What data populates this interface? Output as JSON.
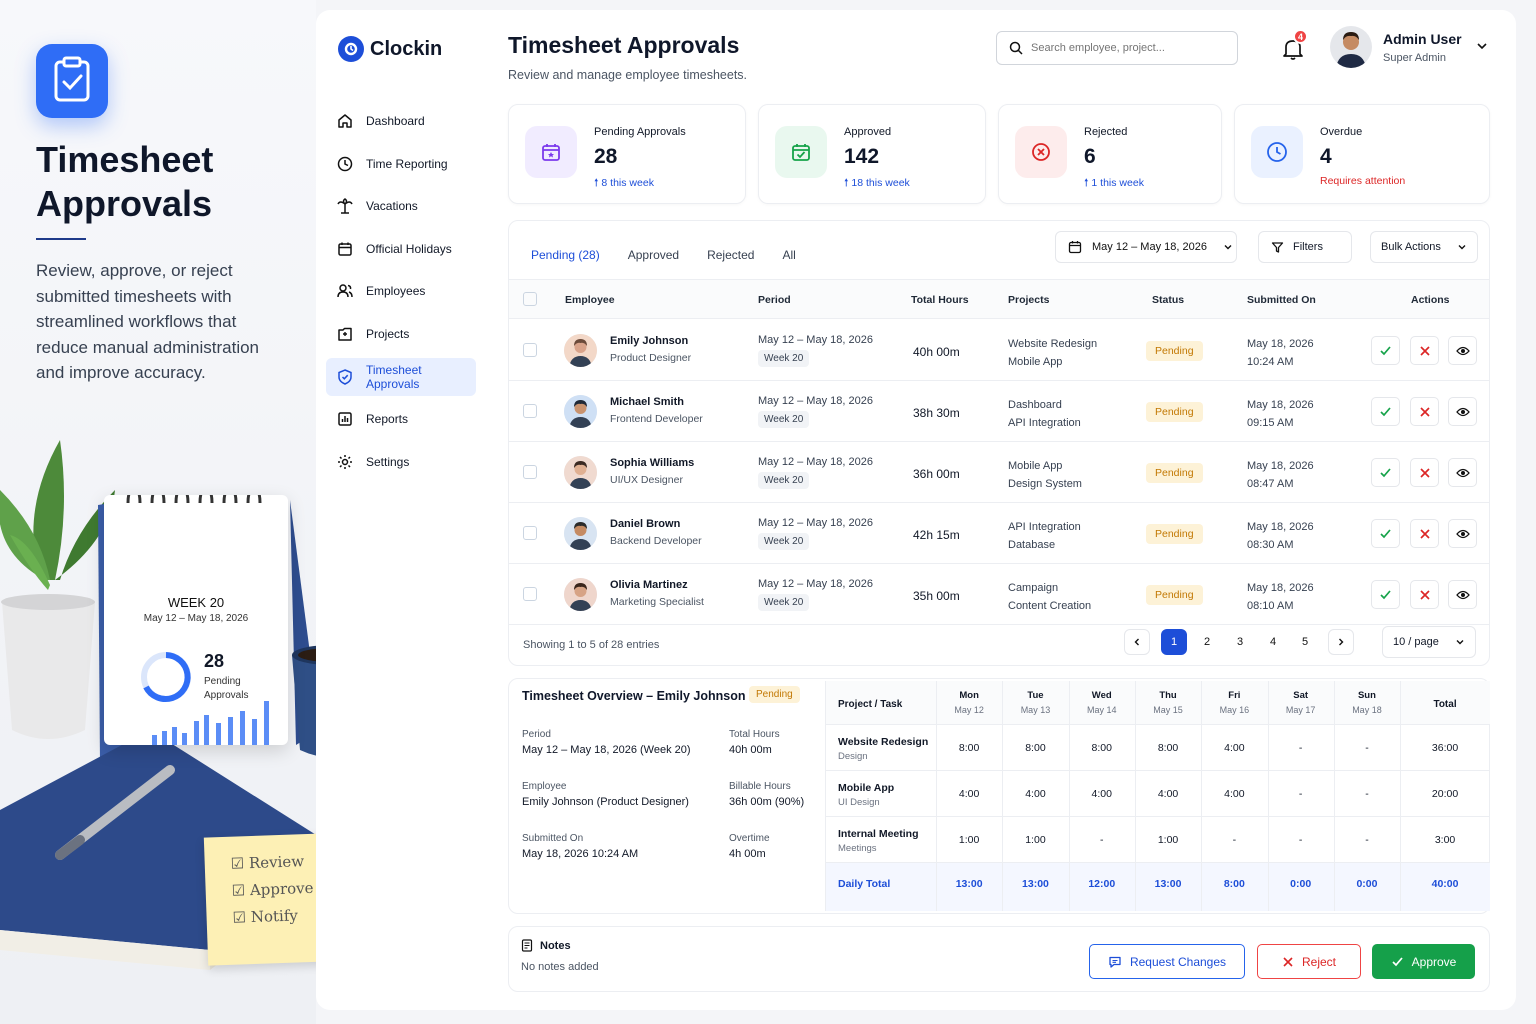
{
  "hero": {
    "title": "Timesheet Approvals",
    "description": "Review, approve, or reject submitted timesheets with streamlined workflows that reduce manual administration and improve accuracy."
  },
  "illustration": {
    "calendar_week": "WEEK 20",
    "calendar_range": "May 12 – May 18, 2026",
    "calendar_count": "28",
    "calendar_label": "Pending Approvals",
    "sticky_items": [
      "Review",
      "Approve",
      "Notify"
    ]
  },
  "brand": {
    "name": "Clockin"
  },
  "nav": [
    {
      "label": "Dashboard",
      "icon": "home-icon"
    },
    {
      "label": "Time Reporting",
      "icon": "clock-icon"
    },
    {
      "label": "Vacations",
      "icon": "palm-tree-icon"
    },
    {
      "label": "Official Holidays",
      "icon": "calendar-icon"
    },
    {
      "label": "Employees",
      "icon": "users-icon"
    },
    {
      "label": "Projects",
      "icon": "folder-icon"
    },
    {
      "label": "Timesheet Approvals",
      "icon": "shield-check-icon",
      "active": true
    },
    {
      "label": "Reports",
      "icon": "chart-icon"
    },
    {
      "label": "Settings",
      "icon": "gear-icon"
    }
  ],
  "header": {
    "title": "Timesheet Approvals",
    "subtitle": "Review and manage employee timesheets.",
    "search_placeholder": "Search employee, project...",
    "notification_count": "4",
    "user_name": "Admin User",
    "user_role": "Super Admin"
  },
  "stats": [
    {
      "label": "Pending Approvals",
      "value": "28",
      "note": "8 this week",
      "color": "#7c3aed",
      "bg": "#f1ecff"
    },
    {
      "label": "Approved",
      "value": "142",
      "note": "18 this week",
      "color": "#16a34a",
      "bg": "#e9f8ef"
    },
    {
      "label": "Rejected",
      "value": "6",
      "note": "1 this week",
      "color": "#dc2626",
      "bg": "#fdecec"
    },
    {
      "label": "Overdue",
      "value": "4",
      "note": "Requires attention",
      "color": "#2563eb",
      "bg": "#eaf1ff"
    }
  ],
  "tabs": [
    "Pending (28)",
    "Approved",
    "Rejected",
    "All"
  ],
  "toolbar": {
    "date_range": "May 12 – May 18, 2026",
    "filters": "Filters",
    "bulk_actions": "Bulk Actions"
  },
  "table": {
    "columns": [
      "Employee",
      "Period",
      "Total Hours",
      "Projects",
      "Status",
      "Submitted On",
      "Actions"
    ],
    "rows": [
      {
        "name": "Emily Johnson",
        "role": "Product Designer",
        "period": "May 12 – May 18, 2026",
        "week": "Week 20",
        "hours": "40h 00m",
        "project1": "Website Redesign",
        "project2": "Mobile App",
        "status": "Pending",
        "date": "May 18, 2026",
        "time": "10:24 AM"
      },
      {
        "name": "Michael Smith",
        "role": "Frontend Developer",
        "period": "May 12 – May 18, 2026",
        "week": "Week 20",
        "hours": "38h 30m",
        "project1": "Dashboard",
        "project2": "API Integration",
        "status": "Pending",
        "date": "May 18, 2026",
        "time": "09:15 AM"
      },
      {
        "name": "Sophia Williams",
        "role": "UI/UX Designer",
        "period": "May 12 – May 18, 2026",
        "week": "Week 20",
        "hours": "36h 00m",
        "project1": "Mobile App",
        "project2": "Design System",
        "status": "Pending",
        "date": "May 18, 2026",
        "time": "08:47 AM"
      },
      {
        "name": "Daniel Brown",
        "role": "Backend Developer",
        "period": "May 12 – May 18, 2026",
        "week": "Week 20",
        "hours": "42h 15m",
        "project1": "API Integration",
        "project2": "Database",
        "status": "Pending",
        "date": "May 18, 2026",
        "time": "08:30 AM"
      },
      {
        "name": "Olivia Martinez",
        "role": "Marketing Specialist",
        "period": "May 12 – May 18, 2026",
        "week": "Week 20",
        "hours": "35h 00m",
        "project1": "Campaign",
        "project2": "Content Creation",
        "status": "Pending",
        "date": "May 18, 2026",
        "time": "08:10 AM"
      }
    ]
  },
  "pagination": {
    "info": "Showing 1 to 5 of 28 entries",
    "pages": [
      "1",
      "2",
      "3",
      "4",
      "5"
    ],
    "per_page": "10 / page"
  },
  "overview": {
    "title": "Timesheet Overview – Emily Johnson",
    "status": "Pending",
    "fields": {
      "period_label": "Period",
      "period_value": "May 12 – May 18, 2026 (Week 20)",
      "total_label": "Total Hours",
      "total_value": "40h 00m",
      "employee_label": "Employee",
      "employee_value": "Emily Johnson (Product Designer)",
      "billable_label": "Billable Hours",
      "billable_value": "36h 00m (90%)",
      "submitted_label": "Submitted On",
      "submitted_value": "May 18, 2026 10:24 AM",
      "overtime_label": "Overtime",
      "overtime_value": "4h 00m"
    },
    "grid": {
      "task_header": "Project / Task",
      "total_header": "Total",
      "days": [
        {
          "day": "Mon",
          "date": "May 12"
        },
        {
          "day": "Tue",
          "date": "May 13"
        },
        {
          "day": "Wed",
          "date": "May 14"
        },
        {
          "day": "Thu",
          "date": "May 15"
        },
        {
          "day": "Fri",
          "date": "May 16"
        },
        {
          "day": "Sat",
          "date": "May 17"
        },
        {
          "day": "Sun",
          "date": "May 18"
        }
      ],
      "rows": [
        {
          "task": "Website Redesign",
          "sub": "Design",
          "values": [
            "8:00",
            "8:00",
            "8:00",
            "8:00",
            "4:00",
            "-",
            "-"
          ],
          "total": "36:00"
        },
        {
          "task": "Mobile App",
          "sub": "UI Design",
          "values": [
            "4:00",
            "4:00",
            "4:00",
            "4:00",
            "4:00",
            "-",
            "-"
          ],
          "total": "20:00"
        },
        {
          "task": "Internal Meeting",
          "sub": "Meetings",
          "values": [
            "1:00",
            "1:00",
            "-",
            "1:00",
            "-",
            "-",
            "-"
          ],
          "total": "3:00"
        }
      ],
      "daily_total_label": "Daily Total",
      "daily_totals": [
        "13:00",
        "13:00",
        "12:00",
        "13:00",
        "8:00",
        "0:00",
        "0:00"
      ],
      "grand_total": "40:00"
    }
  },
  "notes": {
    "title": "Notes",
    "empty": "No notes added",
    "request_changes": "Request Changes",
    "reject": "Reject",
    "approve": "Approve"
  },
  "colors": {
    "primary": "#1d4ed8",
    "approve": "#16a34a",
    "reject": "#dc2626",
    "pending_bg": "#fdf2d7",
    "pending_text": "#c27803"
  }
}
